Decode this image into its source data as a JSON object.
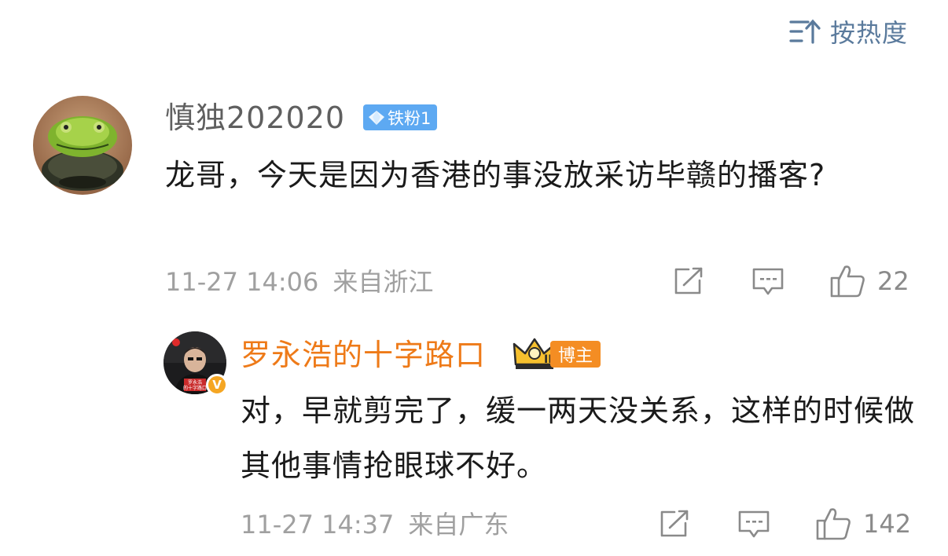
{
  "sort": {
    "label": "按热度",
    "icon": "sort-hot-icon"
  },
  "comments": [
    {
      "username": "慎独202020",
      "fan_badge": "铁粉1",
      "text": "龙哥，今天是因为香港的事没放采访毕赣的播客?",
      "date": "11-27 14:06",
      "location": "来自浙江",
      "likes": "22"
    }
  ],
  "reply": {
    "username": "罗永浩的十字路口",
    "crown_level": "II",
    "host_badge": "博主",
    "avatar_text": "罗永浩 的十字路口",
    "verified_badge": "V",
    "text": "对，早就剪完了，缓一两天没关系，这样的时候做其他事情抢眼球不好。",
    "date": "11-27 14:37",
    "location": "来自广东",
    "likes": "142"
  },
  "colors": {
    "accent_blue": "#5a7a9c",
    "reply_name": "#ee7a18",
    "fan_badge": "#5da9f2",
    "host_badge": "#f48d23",
    "meta_gray": "#a0a0a0"
  }
}
